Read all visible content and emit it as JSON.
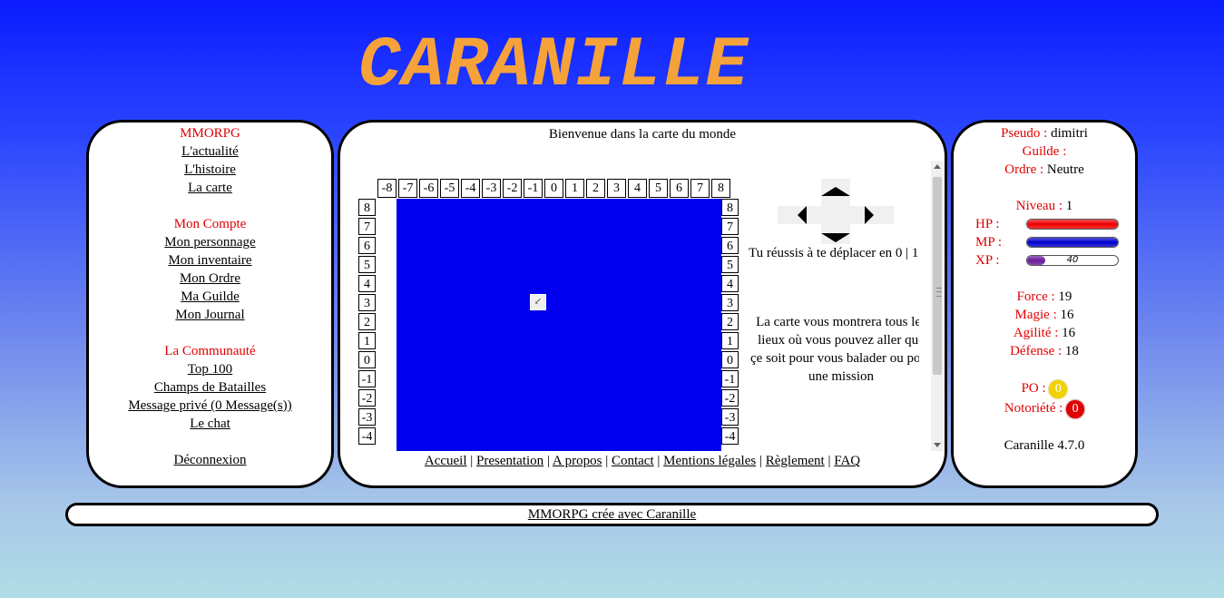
{
  "logo": "CARANILLE",
  "left_menu": {
    "section1_title": "MMORPG",
    "section1_links": [
      "L'actualité",
      "L'histoire",
      "La carte"
    ],
    "section2_title": "Mon Compte",
    "section2_links": [
      "Mon personnage",
      "Mon inventaire",
      "Mon Ordre",
      "Ma Guilde",
      "Mon Journal"
    ],
    "section3_title": "La Communauté",
    "section3_links": [
      "Top 100",
      "Champs de Batailles",
      "Message privé (0 Message(s))",
      "Le chat"
    ],
    "logout": "Déconnexion"
  },
  "center": {
    "title": "Bienvenue dans la carte du monde",
    "x_labels": [
      "-8",
      "-7",
      "-6",
      "-5",
      "-4",
      "-3",
      "-2",
      "-1",
      "0",
      "1",
      "2",
      "3",
      "4",
      "5",
      "6",
      "7",
      "8"
    ],
    "y_labels": [
      "8",
      "7",
      "6",
      "5",
      "4",
      "3",
      "2",
      "1",
      "0",
      "-1",
      "-2",
      "-3",
      "-4"
    ],
    "map_color": "#0000ee",
    "move_text": "Tu réussis à te déplacer en 0 | 1",
    "info_text": "La carte vous montrera tous les lieux où vous pouvez aller que çe soit pour vous balader ou pour une mission",
    "footer_links": [
      "Accueil",
      "Presentation",
      "A propos",
      "Contact",
      "Mentions légales",
      "Règlement",
      "FAQ"
    ]
  },
  "right": {
    "pseudo_label": "Pseudo :",
    "pseudo_value": "dimitri",
    "guilde_label": "Guilde :",
    "guilde_value": "",
    "ordre_label": "Ordre :",
    "ordre_value": "Neutre",
    "niveau_label": "Niveau :",
    "niveau_value": "1",
    "hp_label": "HP :",
    "mp_label": "MP :",
    "xp_label": "XP :",
    "hp_fraction": 1.0,
    "mp_fraction": 1.0,
    "xp_fraction": 0.2,
    "xp_text": "40",
    "hp_color": "#ee0000",
    "mp_color": "#0000cc",
    "xp_color": "#6a1b9a",
    "force_label": "Force :",
    "force_value": "19",
    "magie_label": "Magie :",
    "magie_value": "16",
    "agilite_label": "Agilité :",
    "agilite_value": "16",
    "defense_label": "Défense :",
    "defense_value": "18",
    "po_label": "PO :",
    "po_value": "0",
    "notoriete_label": "Notoriété :",
    "notoriete_value": "0",
    "version": "Caranille 4.7.0"
  },
  "footer": {
    "text": "MMORPG crée avec Caranille"
  }
}
